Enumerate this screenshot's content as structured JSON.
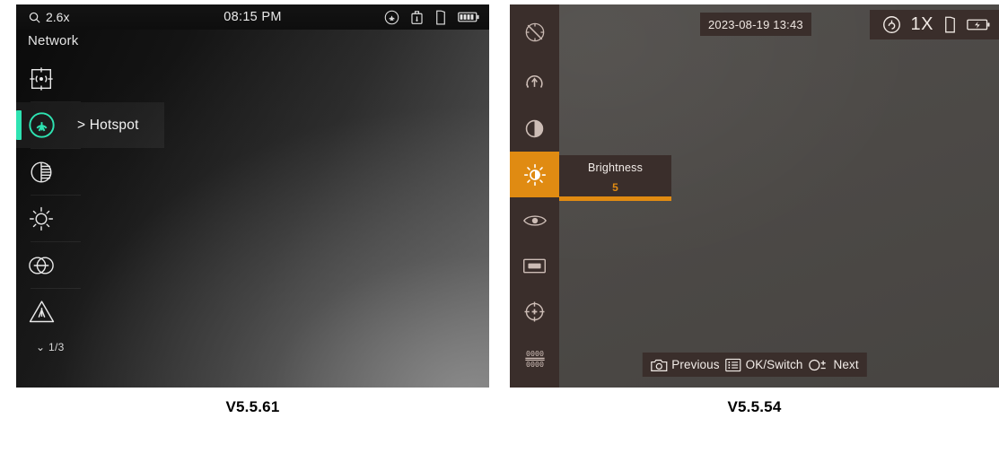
{
  "left_panel": {
    "caption": "V5.5.61",
    "status_bar": {
      "zoom_label": "2.6x",
      "zoom_icon": "magnifier-icon",
      "time": "08:15 PM",
      "icons": [
        "hotspot-icon",
        "usb-icon",
        "sd-card-icon",
        "battery-icon"
      ]
    },
    "menu": {
      "title": "Network",
      "page_indicator": "1/3",
      "page_indicator_icon": "chevron-down-icon",
      "items": [
        {
          "icon": "calibration-ffc-icon",
          "label": "",
          "selected": false
        },
        {
          "icon": "hotspot-icon",
          "label": "> Hotspot",
          "selected": true
        },
        {
          "icon": "contrast-icon",
          "label": "",
          "selected": false
        },
        {
          "icon": "brightness-sun-icon",
          "label": "",
          "selected": false
        },
        {
          "icon": "picture-in-picture-icon",
          "label": "",
          "selected": false
        },
        {
          "icon": "warning-triangle-icon",
          "label": "",
          "selected": false
        }
      ]
    },
    "colors": {
      "accent": "#2ee3b2",
      "text": "#f2f2f2",
      "bar_bg": "#0e0e0e"
    }
  },
  "right_panel": {
    "caption": "V5.5.54",
    "status_bar": {
      "corner_icon": "compass-disabled-icon",
      "time": "2023-08-19 13:43",
      "magnification": "1X",
      "magnification_icon": "magnification-icon",
      "icons": [
        "sd-card-icon",
        "battery-charging-icon"
      ]
    },
    "sidebar": {
      "items": [
        {
          "icon": "calibration-ffc-icon",
          "selected": false
        },
        {
          "icon": "contrast-icon",
          "selected": false
        },
        {
          "icon": "brightness-sun-icon",
          "selected": true
        },
        {
          "icon": "eye-icon",
          "selected": false
        },
        {
          "icon": "screen-rectangle-icon",
          "selected": false
        },
        {
          "icon": "reticle-crosshair-icon",
          "selected": false
        },
        {
          "icon": "digital-readout-icon",
          "selected": false
        }
      ]
    },
    "popup": {
      "title": "Brightness",
      "value": "5",
      "slider_percent": 50
    },
    "bottom_bar": {
      "items": [
        {
          "icon": "camera-icon",
          "label": "Previous"
        },
        {
          "icon": "list-menu-icon",
          "label": "OK/Switch"
        },
        {
          "icon": "zoom-plusminus-icon",
          "label": "Next"
        }
      ]
    },
    "colors": {
      "accent": "#e08b12",
      "chrome": "#3a2e2b",
      "bg": "#4b4845"
    }
  }
}
